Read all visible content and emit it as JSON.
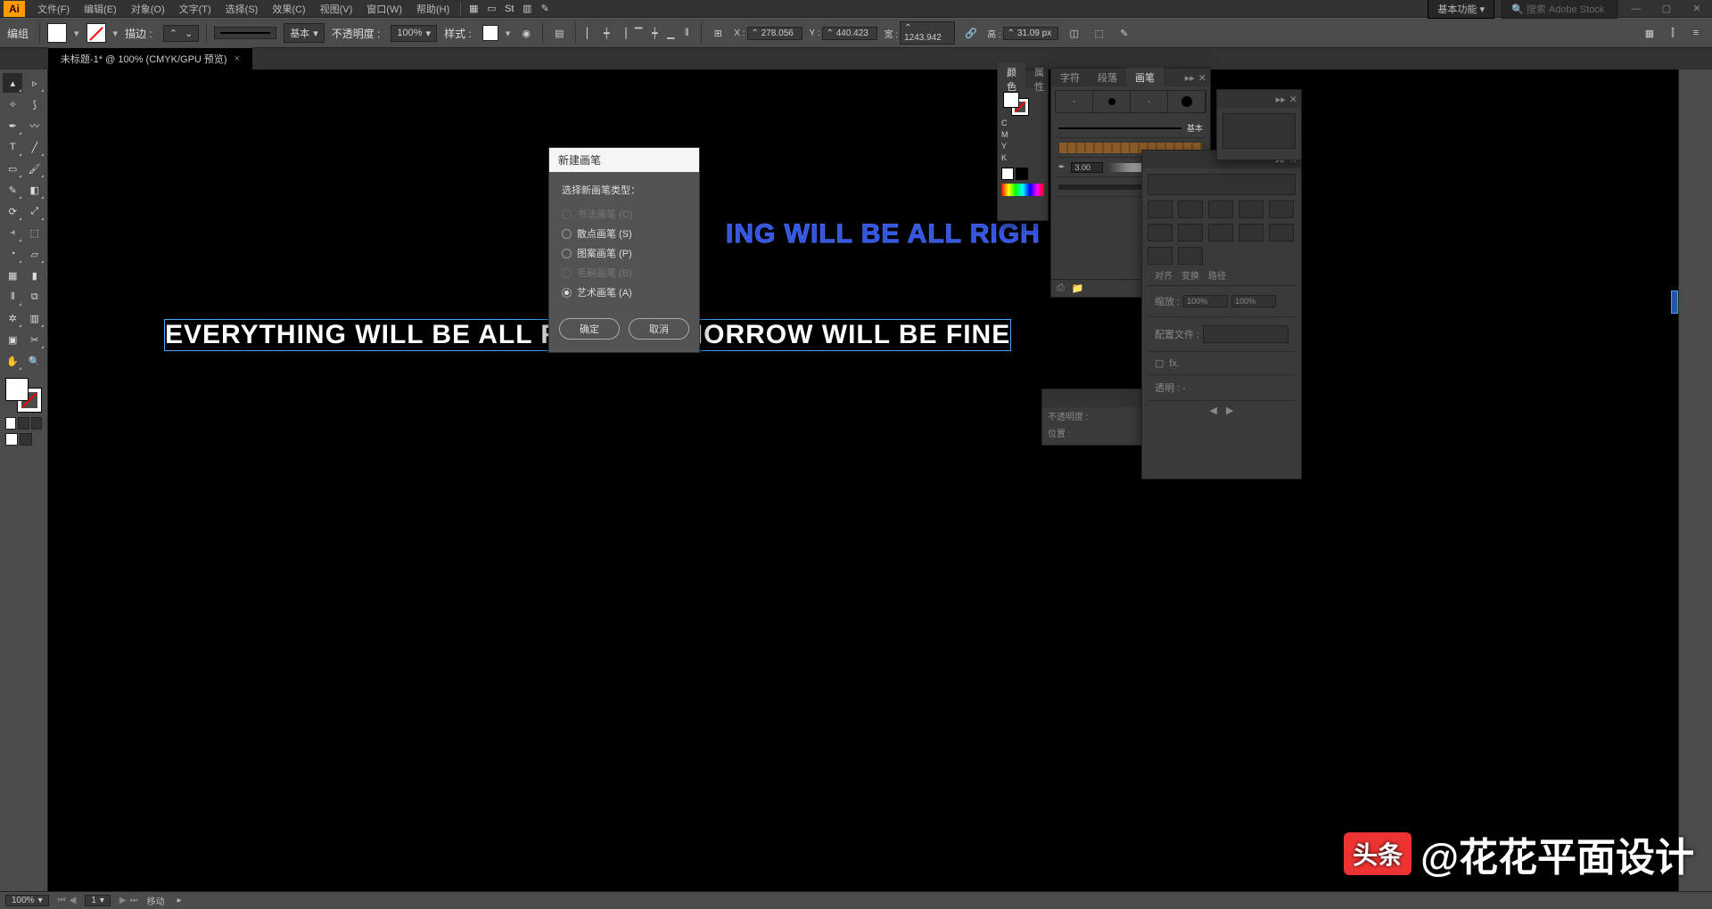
{
  "menubar": {
    "logo": "Ai",
    "items": [
      "文件(F)",
      "编辑(E)",
      "对象(O)",
      "文字(T)",
      "选择(S)",
      "效果(C)",
      "视图(V)",
      "窗口(W)",
      "帮助(H)"
    ],
    "workspace": "基本功能",
    "search_placeholder": "搜索 Adobe Stock"
  },
  "controlbar": {
    "mode": "编组",
    "stroke_label": "描边 :",
    "stroke_dd": "",
    "brush_label": "基本",
    "opacity_label": "不透明度 :",
    "opacity": "100%",
    "style_label": "样式 :",
    "x_label": "X :",
    "x": "278.056",
    "y_label": "Y :",
    "y": "440.423",
    "w_label": "宽 :",
    "w": "1243.942",
    "h_label": "高 :",
    "h": "31.09 px"
  },
  "tab": {
    "title": "未标题-1* @ 100% (CMYK/GPU 预览)",
    "close": "×"
  },
  "canvas": {
    "text_main": "EVERYTHING WILL BE ALL RIGHT, TOMORROW WILL BE FINE",
    "text_ghost": "ING WILL BE ALL RIGH"
  },
  "dialog": {
    "title": "新建画笔",
    "prompt": "选择新画笔类型：",
    "options": [
      {
        "label": "书法画笔 (C)",
        "enabled": false,
        "checked": false
      },
      {
        "label": "散点画笔 (S)",
        "enabled": true,
        "checked": false
      },
      {
        "label": "图案画笔 (P)",
        "enabled": true,
        "checked": false
      },
      {
        "label": "毛刷画笔 (B)",
        "enabled": false,
        "checked": false
      },
      {
        "label": "艺术画笔 (A)",
        "enabled": true,
        "checked": true
      }
    ],
    "ok": "确定",
    "cancel": "取消"
  },
  "panels": {
    "color": {
      "tab1": "颜色",
      "tab2": "属性",
      "channels": [
        "C",
        "M",
        "Y",
        "K"
      ]
    },
    "brush": {
      "tabs": [
        "字符",
        "段落",
        "画笔"
      ],
      "basic": "基本",
      "size": "3.00"
    },
    "attrs": {
      "rows": [
        "不透明度 :",
        "位置 :"
      ]
    },
    "transform": {
      "tabs": [
        "对齐",
        "变换",
        "路径"
      ],
      "opacity": "透明 :",
      "pct1": "100%",
      "pct2": "100%",
      "profile": "配置文件 :"
    }
  },
  "status": {
    "zoom": "100%",
    "page": "1",
    "tool": "移动"
  },
  "watermark": {
    "badge": "头条",
    "text": "@花花平面设计"
  }
}
